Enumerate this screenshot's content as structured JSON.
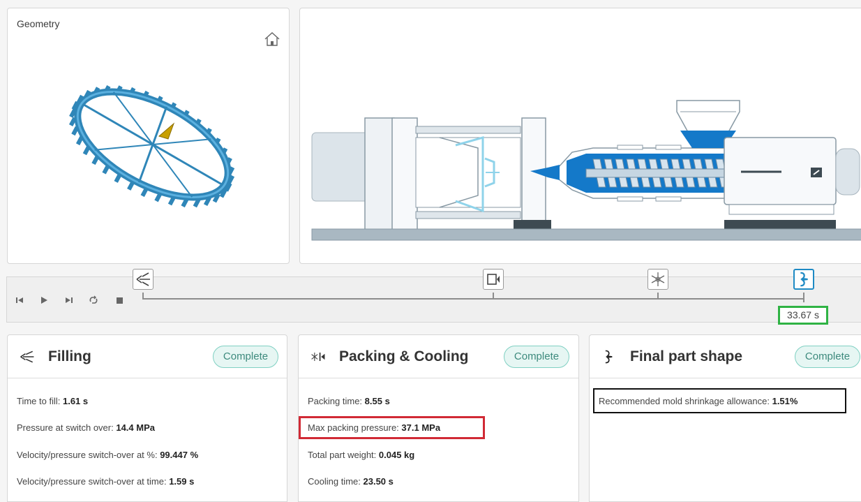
{
  "geometry": {
    "title": "Geometry"
  },
  "timeline": {
    "time": "33.67 s"
  },
  "filling": {
    "title": "Filling",
    "status": "Complete",
    "rows": [
      {
        "label": "Time to fill:",
        "value": "1.61 s"
      },
      {
        "label": "Pressure at switch over:",
        "value": "14.4 MPa"
      },
      {
        "label": "Velocity/pressure switch-over at %:",
        "value": "99.447 %"
      },
      {
        "label": "Velocity/pressure switch-over at time:",
        "value": "1.59 s"
      }
    ]
  },
  "packing": {
    "title": "Packing & Cooling",
    "status": "Complete",
    "rows": [
      {
        "label": "Packing time:",
        "value": "8.55 s"
      },
      {
        "label": "Max packing pressure:",
        "value": "37.1 MPa"
      },
      {
        "label": "Total part weight:",
        "value": "0.045 kg"
      },
      {
        "label": "Cooling time:",
        "value": "23.50 s"
      }
    ]
  },
  "final": {
    "title": "Final part shape",
    "status": "Complete",
    "rows": [
      {
        "label": "Recommended mold shrinkage allowance:",
        "value": "1.51%"
      }
    ]
  },
  "colors": {
    "accent_blue": "#1e8ac4",
    "part_blue": "#3a8fc0",
    "status_green": "#2fb344",
    "badge_teal": "#7fd0c2",
    "highlight_red": "#d12a35"
  },
  "icons": [
    "home-icon",
    "skip-start-icon",
    "play-icon",
    "skip-end-icon",
    "loop-icon",
    "stop-icon",
    "filling-icon",
    "packing-icon",
    "cooling-icon",
    "final-shape-icon"
  ]
}
